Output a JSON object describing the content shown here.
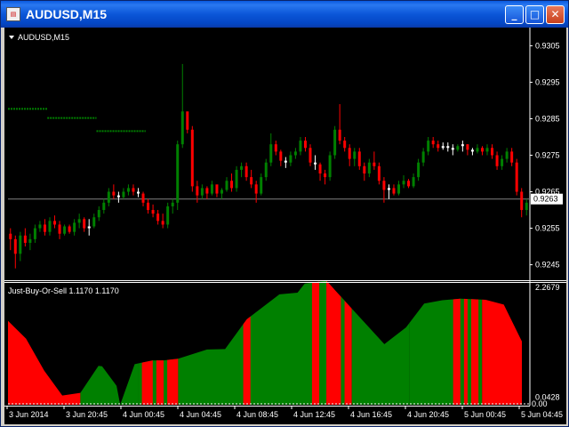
{
  "window": {
    "title": "AUDUSD,M15",
    "buttons": {
      "minimize": "_",
      "maximize": "□",
      "close": "✕"
    }
  },
  "main_chart": {
    "label": "AUDUSD,M15",
    "current_price": "0.9263",
    "y_ticks": [
      "0.9305",
      "0.9295",
      "0.9285",
      "0.9275",
      "0.9265",
      "0.9255",
      "0.9245"
    ]
  },
  "indicator": {
    "label": "Just-Buy-Or-Sell 1.1170 1.1170",
    "y_ticks": [
      "2.2679",
      "0.0428",
      "0.00"
    ]
  },
  "x_ticks": [
    "3 Jun 2014",
    "3 Jun 20:45",
    "4 Jun 00:45",
    "4 Jun 04:45",
    "4 Jun 08:45",
    "4 Jun 12:45",
    "4 Jun 16:45",
    "4 Jun 20:45",
    "5 Jun 00:45",
    "5 Jun 04:45"
  ],
  "colors": {
    "bull": "#008000",
    "bear": "#ff0000",
    "background": "#000000",
    "axis": "#ffffff",
    "price_line": "#808080",
    "doji": "#ffffff"
  },
  "chart_data": [
    {
      "type": "candlestick",
      "title": "AUDUSD,M15",
      "ylim": [
        0.9241,
        0.9309
      ],
      "current_price": 0.9263,
      "levels": [
        {
          "from_index": 0,
          "to_index": 8,
          "value": 0.92877
        },
        {
          "from_index": 8,
          "to_index": 18,
          "value": 0.92852
        },
        {
          "from_index": 18,
          "to_index": 28,
          "value": 0.92816
        }
      ],
      "ohlc": [
        [
          0.92535,
          0.9255,
          0.9249,
          0.9252
        ],
        [
          0.9252,
          0.9253,
          0.9244,
          0.9248
        ],
        [
          0.9248,
          0.9254,
          0.9246,
          0.9253
        ],
        [
          0.9253,
          0.9255,
          0.925,
          0.9251
        ],
        [
          0.9251,
          0.92535,
          0.9249,
          0.9252
        ],
        [
          0.9252,
          0.9256,
          0.9251,
          0.9255
        ],
        [
          0.9255,
          0.9257,
          0.9254,
          0.9256
        ],
        [
          0.9256,
          0.92575,
          0.9253,
          0.9254
        ],
        [
          0.9254,
          0.9258,
          0.9253,
          0.9257
        ],
        [
          0.9257,
          0.92585,
          0.9255,
          0.9256
        ],
        [
          0.9256,
          0.9257,
          0.9252,
          0.92535
        ],
        [
          0.92535,
          0.9256,
          0.9253,
          0.92555
        ],
        [
          0.92555,
          0.9256,
          0.92535,
          0.9254
        ],
        [
          0.9254,
          0.92575,
          0.9253,
          0.92565
        ],
        [
          0.92565,
          0.9259,
          0.9255,
          0.92575
        ],
        [
          0.92575,
          0.9258,
          0.9254,
          0.9255
        ],
        [
          0.9255,
          0.92575,
          0.9253,
          0.92555
        ],
        [
          0.92555,
          0.9259,
          0.9255,
          0.9258
        ],
        [
          0.9258,
          0.9261,
          0.9257,
          0.926
        ],
        [
          0.926,
          0.9263,
          0.9259,
          0.9262
        ],
        [
          0.9262,
          0.9266,
          0.9261,
          0.9265
        ],
        [
          0.9265,
          0.9267,
          0.9263,
          0.9264
        ],
        [
          0.9264,
          0.9265,
          0.9262,
          0.92635
        ],
        [
          0.92635,
          0.9266,
          0.9263,
          0.9265
        ],
        [
          0.9265,
          0.9267,
          0.9264,
          0.9266
        ],
        [
          0.9266,
          0.9267,
          0.9264,
          0.9265
        ],
        [
          0.9265,
          0.9266,
          0.92635,
          0.92645
        ],
        [
          0.92645,
          0.9265,
          0.9261,
          0.9262
        ],
        [
          0.9262,
          0.9263,
          0.9259,
          0.926
        ],
        [
          0.926,
          0.92615,
          0.9258,
          0.9259
        ],
        [
          0.9259,
          0.926,
          0.9256,
          0.9257
        ],
        [
          0.9257,
          0.9259,
          0.9255,
          0.9256
        ],
        [
          0.9256,
          0.9262,
          0.9255,
          0.9261
        ],
        [
          0.9261,
          0.9263,
          0.9259,
          0.9262
        ],
        [
          0.9262,
          0.9279,
          0.926,
          0.9278
        ],
        [
          0.9278,
          0.93,
          0.9277,
          0.9287
        ],
        [
          0.9287,
          0.9286,
          0.9281,
          0.9282
        ],
        [
          0.9282,
          0.9283,
          0.9265,
          0.92665
        ],
        [
          0.92665,
          0.9268,
          0.9262,
          0.9264
        ],
        [
          0.9264,
          0.9267,
          0.9263,
          0.9266
        ],
        [
          0.9266,
          0.92665,
          0.9263,
          0.92645
        ],
        [
          0.92645,
          0.9268,
          0.9264,
          0.9267
        ],
        [
          0.9267,
          0.92665,
          0.92635,
          0.92645
        ],
        [
          0.92645,
          0.9266,
          0.9263,
          0.92655
        ],
        [
          0.92655,
          0.9269,
          0.9265,
          0.9268
        ],
        [
          0.9268,
          0.927,
          0.9265,
          0.9266
        ],
        [
          0.9266,
          0.9272,
          0.9265,
          0.9271
        ],
        [
          0.9271,
          0.9273,
          0.9269,
          0.9272
        ],
        [
          0.9272,
          0.9273,
          0.9268,
          0.9269
        ],
        [
          0.9269,
          0.9271,
          0.9266,
          0.9267
        ],
        [
          0.9267,
          0.9268,
          0.9262,
          0.92645
        ],
        [
          0.92645,
          0.927,
          0.9264,
          0.9269
        ],
        [
          0.9269,
          0.9274,
          0.9268,
          0.9273
        ],
        [
          0.9273,
          0.9281,
          0.9272,
          0.9278
        ],
        [
          0.9278,
          0.9279,
          0.9275,
          0.9276
        ],
        [
          0.9276,
          0.92765,
          0.9272,
          0.92735
        ],
        [
          0.92735,
          0.92745,
          0.92715,
          0.9273
        ],
        [
          0.9273,
          0.9276,
          0.9272,
          0.9275
        ],
        [
          0.9275,
          0.9277,
          0.9274,
          0.9276
        ],
        [
          0.9276,
          0.928,
          0.9275,
          0.9279
        ],
        [
          0.9279,
          0.928,
          0.9276,
          0.9277
        ],
        [
          0.9277,
          0.9278,
          0.9272,
          0.9273
        ],
        [
          0.9273,
          0.9275,
          0.9271,
          0.92725
        ],
        [
          0.92725,
          0.9273,
          0.9268,
          0.927
        ],
        [
          0.927,
          0.9271,
          0.9267,
          0.9269
        ],
        [
          0.9269,
          0.9276,
          0.9268,
          0.9275
        ],
        [
          0.9275,
          0.9283,
          0.9274,
          0.9282
        ],
        [
          0.9282,
          0.9289,
          0.9278,
          0.9279
        ],
        [
          0.9279,
          0.928,
          0.9276,
          0.9277
        ],
        [
          0.9277,
          0.9278,
          0.9272,
          0.9274
        ],
        [
          0.9274,
          0.9277,
          0.9272,
          0.9276
        ],
        [
          0.9276,
          0.9277,
          0.9271,
          0.9272
        ],
        [
          0.9272,
          0.9273,
          0.9268,
          0.927
        ],
        [
          0.927,
          0.9274,
          0.9269,
          0.9273
        ],
        [
          0.9273,
          0.9276,
          0.9271,
          0.9272
        ],
        [
          0.9272,
          0.9273,
          0.9267,
          0.9268
        ],
        [
          0.9268,
          0.9269,
          0.9262,
          0.92655
        ],
        [
          0.92655,
          0.9267,
          0.9263,
          0.9266
        ],
        [
          0.9266,
          0.9267,
          0.9264,
          0.92645
        ],
        [
          0.92645,
          0.9268,
          0.9264,
          0.9267
        ],
        [
          0.9267,
          0.92695,
          0.9266,
          0.9268
        ],
        [
          0.9268,
          0.92685,
          0.9266,
          0.92665
        ],
        [
          0.92665,
          0.927,
          0.9266,
          0.9269
        ],
        [
          0.9269,
          0.9274,
          0.9268,
          0.9273
        ],
        [
          0.9273,
          0.9277,
          0.9272,
          0.9276
        ],
        [
          0.9276,
          0.928,
          0.9275,
          0.9279
        ],
        [
          0.9279,
          0.928,
          0.9277,
          0.9278
        ],
        [
          0.9278,
          0.9279,
          0.9276,
          0.9277
        ],
        [
          0.9277,
          0.92785,
          0.92765,
          0.92775
        ],
        [
          0.92775,
          0.92785,
          0.9276,
          0.9277
        ],
        [
          0.9277,
          0.9278,
          0.9275,
          0.92765
        ],
        [
          0.92765,
          0.9278,
          0.9276,
          0.92775
        ],
        [
          0.92775,
          0.9279,
          0.9276,
          0.9278
        ],
        [
          0.9278,
          0.9278,
          0.9275,
          0.92765
        ],
        [
          0.92765,
          0.9277,
          0.9275,
          0.9276
        ],
        [
          0.9276,
          0.9278,
          0.92755,
          0.9277
        ],
        [
          0.9277,
          0.92775,
          0.9275,
          0.9276
        ],
        [
          0.9276,
          0.9278,
          0.9275,
          0.9277
        ],
        [
          0.9277,
          0.9278,
          0.9274,
          0.9275
        ],
        [
          0.9275,
          0.9276,
          0.9271,
          0.9272
        ],
        [
          0.9272,
          0.9275,
          0.9271,
          0.9274
        ],
        [
          0.9274,
          0.9277,
          0.9273,
          0.9276
        ],
        [
          0.9276,
          0.9277,
          0.9272,
          0.9273
        ],
        [
          0.9273,
          0.9274,
          0.9264,
          0.9265
        ],
        [
          0.9265,
          0.9266,
          0.9258,
          0.926
        ],
        [
          0.926,
          0.9263,
          0.92585,
          0.9262
        ]
      ]
    },
    {
      "type": "area",
      "title": "Just-Buy-Or-Sell 1.1170 1.1170",
      "ylim": [
        0,
        2.2679
      ],
      "x": [
        0,
        5,
        10,
        15,
        20,
        25,
        26,
        30,
        31,
        35,
        40,
        43,
        47,
        55,
        60,
        66,
        75,
        80,
        82,
        88,
        94,
        104,
        110,
        115,
        120,
        125,
        132,
        137,
        142
      ],
      "values": [
        1.55,
        1.22,
        0.63,
        0.17,
        0.22,
        0.72,
        0.71,
        0.35,
        0.0,
        0.75,
        0.82,
        0.82,
        0.85,
        1.02,
        1.03,
        1.58,
        2.04,
        2.07,
        2.24,
        2.29,
        1.85,
        1.12,
        1.43,
        1.87,
        1.93,
        1.96,
        1.94,
        1.85,
        1.17
      ],
      "segments": [
        {
          "from": 0,
          "to": 20,
          "signal": "sell"
        },
        {
          "from": 20,
          "to": 36,
          "signal": "buy"
        },
        {
          "from": 36,
          "to": 47,
          "signal": "buy"
        },
        {
          "from": 47,
          "to": 65,
          "signal": "buy"
        },
        {
          "from": 65,
          "to": 88,
          "signal": "buy"
        },
        {
          "from": 88,
          "to": 95,
          "signal": "sell"
        },
        {
          "from": 95,
          "to": 111,
          "signal": "buy"
        },
        {
          "from": 111,
          "to": 131,
          "signal": "buy"
        },
        {
          "from": 131,
          "to": 142,
          "signal": "sell"
        }
      ],
      "stripes": [
        {
          "from": 37,
          "to": 40,
          "signal": "sell"
        },
        {
          "from": 41,
          "to": 43,
          "signal": "sell"
        },
        {
          "from": 44,
          "to": 47,
          "signal": "sell"
        },
        {
          "from": 65,
          "to": 67,
          "signal": "sell"
        },
        {
          "from": 84,
          "to": 86,
          "signal": "sell"
        },
        {
          "from": 88,
          "to": 90,
          "signal": "sell"
        },
        {
          "from": 92,
          "to": 93,
          "signal": "buy"
        },
        {
          "from": 123,
          "to": 125,
          "signal": "sell"
        },
        {
          "from": 126,
          "to": 127,
          "signal": "sell"
        },
        {
          "from": 128,
          "to": 130,
          "signal": "sell"
        }
      ]
    }
  ]
}
